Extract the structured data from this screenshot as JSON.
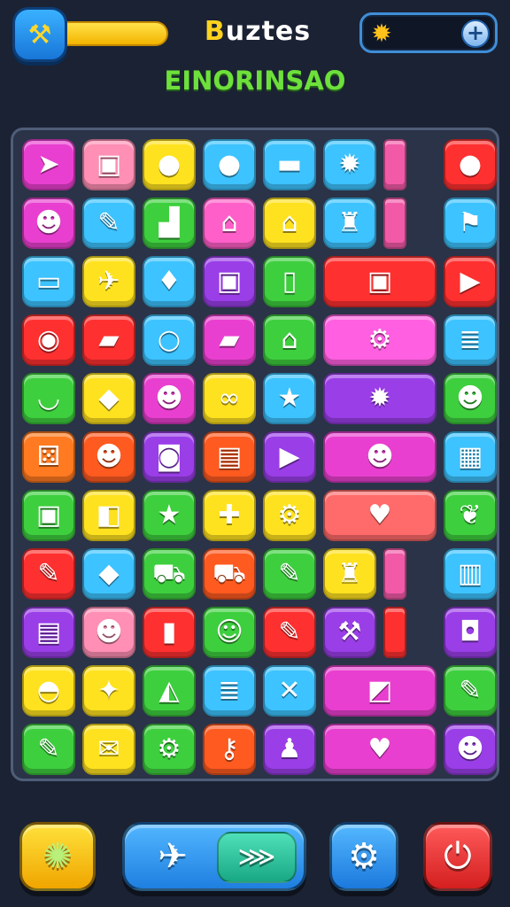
{
  "header": {
    "title_first": "B",
    "title_rest": "uztes",
    "subtitle": "EINORINSAO",
    "hammer_icon": "hammer-icon",
    "energy_level_percent": 100,
    "coin_icon": "sun-coin-icon",
    "plus_label": "+"
  },
  "board": {
    "rows": [
      [
        {
          "color": "#e93fd0",
          "icon": "paper-plane-icon",
          "glyph": "➤"
        },
        {
          "color": "#ff8fb4",
          "icon": "treasure-chest-icon",
          "glyph": "▣"
        },
        {
          "color": "#ffe21f",
          "icon": "green-slime-icon",
          "glyph": "●"
        },
        {
          "color": "#3dc3ff",
          "icon": "strawberry-icon",
          "glyph": "●"
        },
        {
          "color": "#3dc3ff",
          "icon": "pencil-icon",
          "glyph": "▬"
        },
        {
          "color": "#3dc3ff",
          "icon": "sun-icon",
          "glyph": "✹"
        },
        {
          "color": "#f25aa8",
          "icon": "pink-bar-tile",
          "glyph": ""
        },
        {
          "color": "#ff3030",
          "icon": "lollipop-icon",
          "glyph": "●"
        }
      ],
      [
        {
          "color": "#e93fd0",
          "icon": "smiley-block-icon",
          "glyph": "☻"
        },
        {
          "color": "#3dc3ff",
          "icon": "paintbrush-icon",
          "glyph": "✎"
        },
        {
          "color": "#3ecf3e",
          "icon": "stairs-icon",
          "glyph": "▟"
        },
        {
          "color": "#ff5fc8",
          "icon": "house-roof-icon",
          "glyph": "⌂"
        },
        {
          "color": "#ffe21f",
          "icon": "shrine-icon",
          "glyph": "⌂"
        },
        {
          "color": "#3dc3ff",
          "icon": "green-castle-icon",
          "glyph": "♜"
        },
        {
          "color": "#f25aa8",
          "icon": "pink-bar-tile",
          "glyph": ""
        },
        {
          "color": "#3dc3ff",
          "icon": "flag-icon",
          "glyph": "⚑"
        }
      ],
      [
        {
          "color": "#3dc3ff",
          "icon": "yellow-card-icon",
          "glyph": "▭"
        },
        {
          "color": "#ffe21f",
          "icon": "rocket-icon",
          "glyph": "✈"
        },
        {
          "color": "#3dc3ff",
          "icon": "pink-lamp-icon",
          "glyph": "♦"
        },
        {
          "color": "#9a3ee8",
          "icon": "picture-frame-icon",
          "glyph": "▣"
        },
        {
          "color": "#3ecf3e",
          "icon": "door-icon",
          "glyph": "▯"
        },
        {
          "color": "#ff3030",
          "icon": "robot-icon",
          "glyph": "▣",
          "wide": true
        },
        {
          "color": "#ff3030",
          "icon": "play-triangle-icon",
          "glyph": "▶"
        }
      ],
      [
        {
          "color": "#ff3030",
          "icon": "red-ring-icon",
          "glyph": "◉"
        },
        {
          "color": "#ff3030",
          "icon": "eraser-icon",
          "glyph": "▰"
        },
        {
          "color": "#3dc3ff",
          "icon": "ring-icon",
          "glyph": "○"
        },
        {
          "color": "#e93fd0",
          "icon": "green-book-icon",
          "glyph": "▰"
        },
        {
          "color": "#3ecf3e",
          "icon": "house-icon",
          "glyph": "⌂"
        },
        {
          "color": "#ff5fe0",
          "icon": "gear-icon",
          "glyph": "⚙",
          "wide": true
        },
        {
          "color": "#3dc3ff",
          "icon": "paper-stack-icon",
          "glyph": "≣"
        }
      ],
      [
        {
          "color": "#3ecf3e",
          "icon": "bowl-icon",
          "glyph": "◡"
        },
        {
          "color": "#ffe21f",
          "icon": "gem-icon",
          "glyph": "◆"
        },
        {
          "color": "#e93fd0",
          "icon": "red-monster-icon",
          "glyph": "☻"
        },
        {
          "color": "#ffe21f",
          "icon": "chain-icon",
          "glyph": "∞"
        },
        {
          "color": "#3dc3ff",
          "icon": "star-icon",
          "glyph": "★"
        },
        {
          "color": "#9a3ee8",
          "icon": "sun-icon",
          "glyph": "✹",
          "wide": true
        },
        {
          "color": "#3ecf3e",
          "icon": "red-smiley-icon",
          "glyph": "☻"
        }
      ],
      [
        {
          "color": "#ff7a20",
          "icon": "dice-icon",
          "glyph": "⚄"
        },
        {
          "color": "#ff5a20",
          "icon": "lion-face-icon",
          "glyph": "☻"
        },
        {
          "color": "#9a3ee8",
          "icon": "cup-icon",
          "glyph": "◙"
        },
        {
          "color": "#ff5a20",
          "icon": "crate-icon",
          "glyph": "▤"
        },
        {
          "color": "#9a3ee8",
          "icon": "play-triangle-icon",
          "glyph": "▶"
        },
        {
          "color": "#e93fd0",
          "icon": "cookie-face-icon",
          "glyph": "☻",
          "wide": true
        },
        {
          "color": "#3dc3ff",
          "icon": "waffle-icon",
          "glyph": "▦"
        }
      ],
      [
        {
          "color": "#3ecf3e",
          "icon": "picture-icon",
          "glyph": "▣"
        },
        {
          "color": "#ffe21f",
          "icon": "green-cube-icon",
          "glyph": "◧"
        },
        {
          "color": "#3ecf3e",
          "icon": "orange-star-icon",
          "glyph": "★"
        },
        {
          "color": "#ffe21f",
          "icon": "bone-icon",
          "glyph": "✚"
        },
        {
          "color": "#ffe21f",
          "icon": "cog-icon",
          "glyph": "⚙"
        },
        {
          "color": "#ff6a6a",
          "icon": "heart-icon",
          "glyph": "♥",
          "wide": true
        },
        {
          "color": "#3ecf3e",
          "icon": "leaf-icon",
          "glyph": "❦"
        }
      ],
      [
        {
          "color": "#ff3030",
          "icon": "crayon-icon",
          "glyph": "✎"
        },
        {
          "color": "#3dc3ff",
          "icon": "orange-box-icon",
          "glyph": "◆"
        },
        {
          "color": "#3ecf3e",
          "icon": "cart-icon",
          "glyph": "⛟"
        },
        {
          "color": "#ff5a20",
          "icon": "car-icon",
          "glyph": "⛟"
        },
        {
          "color": "#3ecf3e",
          "icon": "purple-crayon-icon",
          "glyph": "✎"
        },
        {
          "color": "#ffe21f",
          "icon": "bell-icon",
          "glyph": "♜"
        },
        {
          "color": "#f25aa8",
          "icon": "pink-bar-tile",
          "glyph": ""
        },
        {
          "color": "#3dc3ff",
          "icon": "building-icon",
          "glyph": "▥"
        }
      ],
      [
        {
          "color": "#9a3ee8",
          "icon": "toolbox-icon",
          "glyph": "▤"
        },
        {
          "color": "#ff8fb4",
          "icon": "green-face-icon",
          "glyph": "☻"
        },
        {
          "color": "#ff3030",
          "icon": "purple-book-icon",
          "glyph": "▮"
        },
        {
          "color": "#3ecf3e",
          "icon": "smiley-icon",
          "glyph": "☺"
        },
        {
          "color": "#ff3030",
          "icon": "crayon-yellow-icon",
          "glyph": "✎"
        },
        {
          "color": "#9a3ee8",
          "icon": "hammer-icon",
          "glyph": "⚒"
        },
        {
          "color": "#ff3030",
          "icon": "red-bar-tile",
          "glyph": ""
        },
        {
          "color": "#9a3ee8",
          "icon": "shopping-bag-icon",
          "glyph": "◘"
        }
      ],
      [
        {
          "color": "#ffe21f",
          "icon": "red-cap-icon",
          "glyph": "◓"
        },
        {
          "color": "#ffe21f",
          "icon": "green-dragon-icon",
          "glyph": "✦"
        },
        {
          "color": "#3ecf3e",
          "icon": "cheese-icon",
          "glyph": "◭"
        },
        {
          "color": "#3dc3ff",
          "icon": "purple-note-icon",
          "glyph": "≣"
        },
        {
          "color": "#3dc3ff",
          "icon": "cross-icon",
          "glyph": "✕"
        },
        {
          "color": "#e93fd0",
          "icon": "gift-box-icon",
          "glyph": "◩",
          "wide": true
        },
        {
          "color": "#3ecf3e",
          "icon": "brush-icon",
          "glyph": "✎"
        }
      ],
      [
        {
          "color": "#3ecf3e",
          "icon": "red-pencil-icon",
          "glyph": "✎"
        },
        {
          "color": "#ffe21f",
          "icon": "envelope-icon",
          "glyph": "✉"
        },
        {
          "color": "#3ecf3e",
          "icon": "gear-icon",
          "glyph": "⚙"
        },
        {
          "color": "#ff5a20",
          "icon": "key-icon",
          "glyph": "⚷"
        },
        {
          "color": "#9a3ee8",
          "icon": "bell-icon",
          "glyph": "♟"
        },
        {
          "color": "#e93fd0",
          "icon": "heart-icon",
          "glyph": "♥",
          "wide": true
        },
        {
          "color": "#9a3ee8",
          "icon": "yellow-face-icon",
          "glyph": "☻"
        }
      ]
    ]
  },
  "footer": {
    "shuffle_icon": "shuffle-splat-icon",
    "airplane_icon": "airplane-icon",
    "fish_icon": "fish-icon",
    "settings_icon": "settings-gear-icon",
    "exit_icon": "exit-icon"
  }
}
